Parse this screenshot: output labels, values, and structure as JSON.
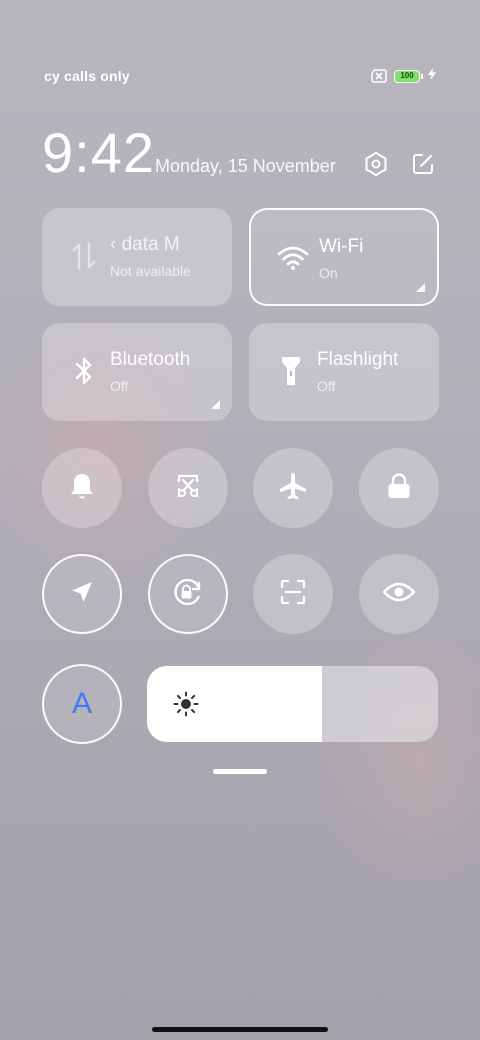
{
  "status_bar": {
    "carrier": "cy calls only",
    "battery_level": "100",
    "icons": [
      "no-sim-icon",
      "battery-icon",
      "charging-icon"
    ]
  },
  "header": {
    "time": "9:42",
    "date": "Monday, 15 November",
    "icons": [
      "settings-icon",
      "edit-icon"
    ]
  },
  "tiles": [
    {
      "title": "‹ data   M",
      "subtitle": "Not available",
      "icon": "mobile-data-icon",
      "active": false
    },
    {
      "title": "Wi-Fi",
      "subtitle": "On",
      "icon": "wifi-icon",
      "active": true
    },
    {
      "title": "Bluetooth",
      "subtitle": "Off",
      "icon": "bluetooth-icon",
      "active": false
    },
    {
      "title": "Flashlight",
      "subtitle": "Off",
      "icon": "flashlight-icon",
      "active": false
    }
  ],
  "toggles": [
    {
      "name": "ring-mode-toggle",
      "icon": "bell-icon",
      "active": false
    },
    {
      "name": "screenshot-toggle",
      "icon": "screenshot-icon",
      "active": false
    },
    {
      "name": "airplane-mode-toggle",
      "icon": "airplane-icon",
      "active": false
    },
    {
      "name": "lock-screen-toggle",
      "icon": "lock-icon",
      "active": false
    },
    {
      "name": "location-toggle",
      "icon": "location-arrow-icon",
      "active": true
    },
    {
      "name": "auto-rotate-toggle",
      "icon": "rotation-lock-icon",
      "active": true
    },
    {
      "name": "scanner-toggle",
      "icon": "scan-icon",
      "active": false
    },
    {
      "name": "reading-mode-toggle",
      "icon": "eye-icon",
      "active": false
    }
  ],
  "auto_brightness": {
    "label": "A",
    "active": true,
    "color": "#3b7cf2"
  },
  "brightness": {
    "level_percent": 60,
    "icon": "sun-icon"
  },
  "colors": {
    "active_accent": "#3b7cf2",
    "battery_fill": "#7fe06c"
  }
}
